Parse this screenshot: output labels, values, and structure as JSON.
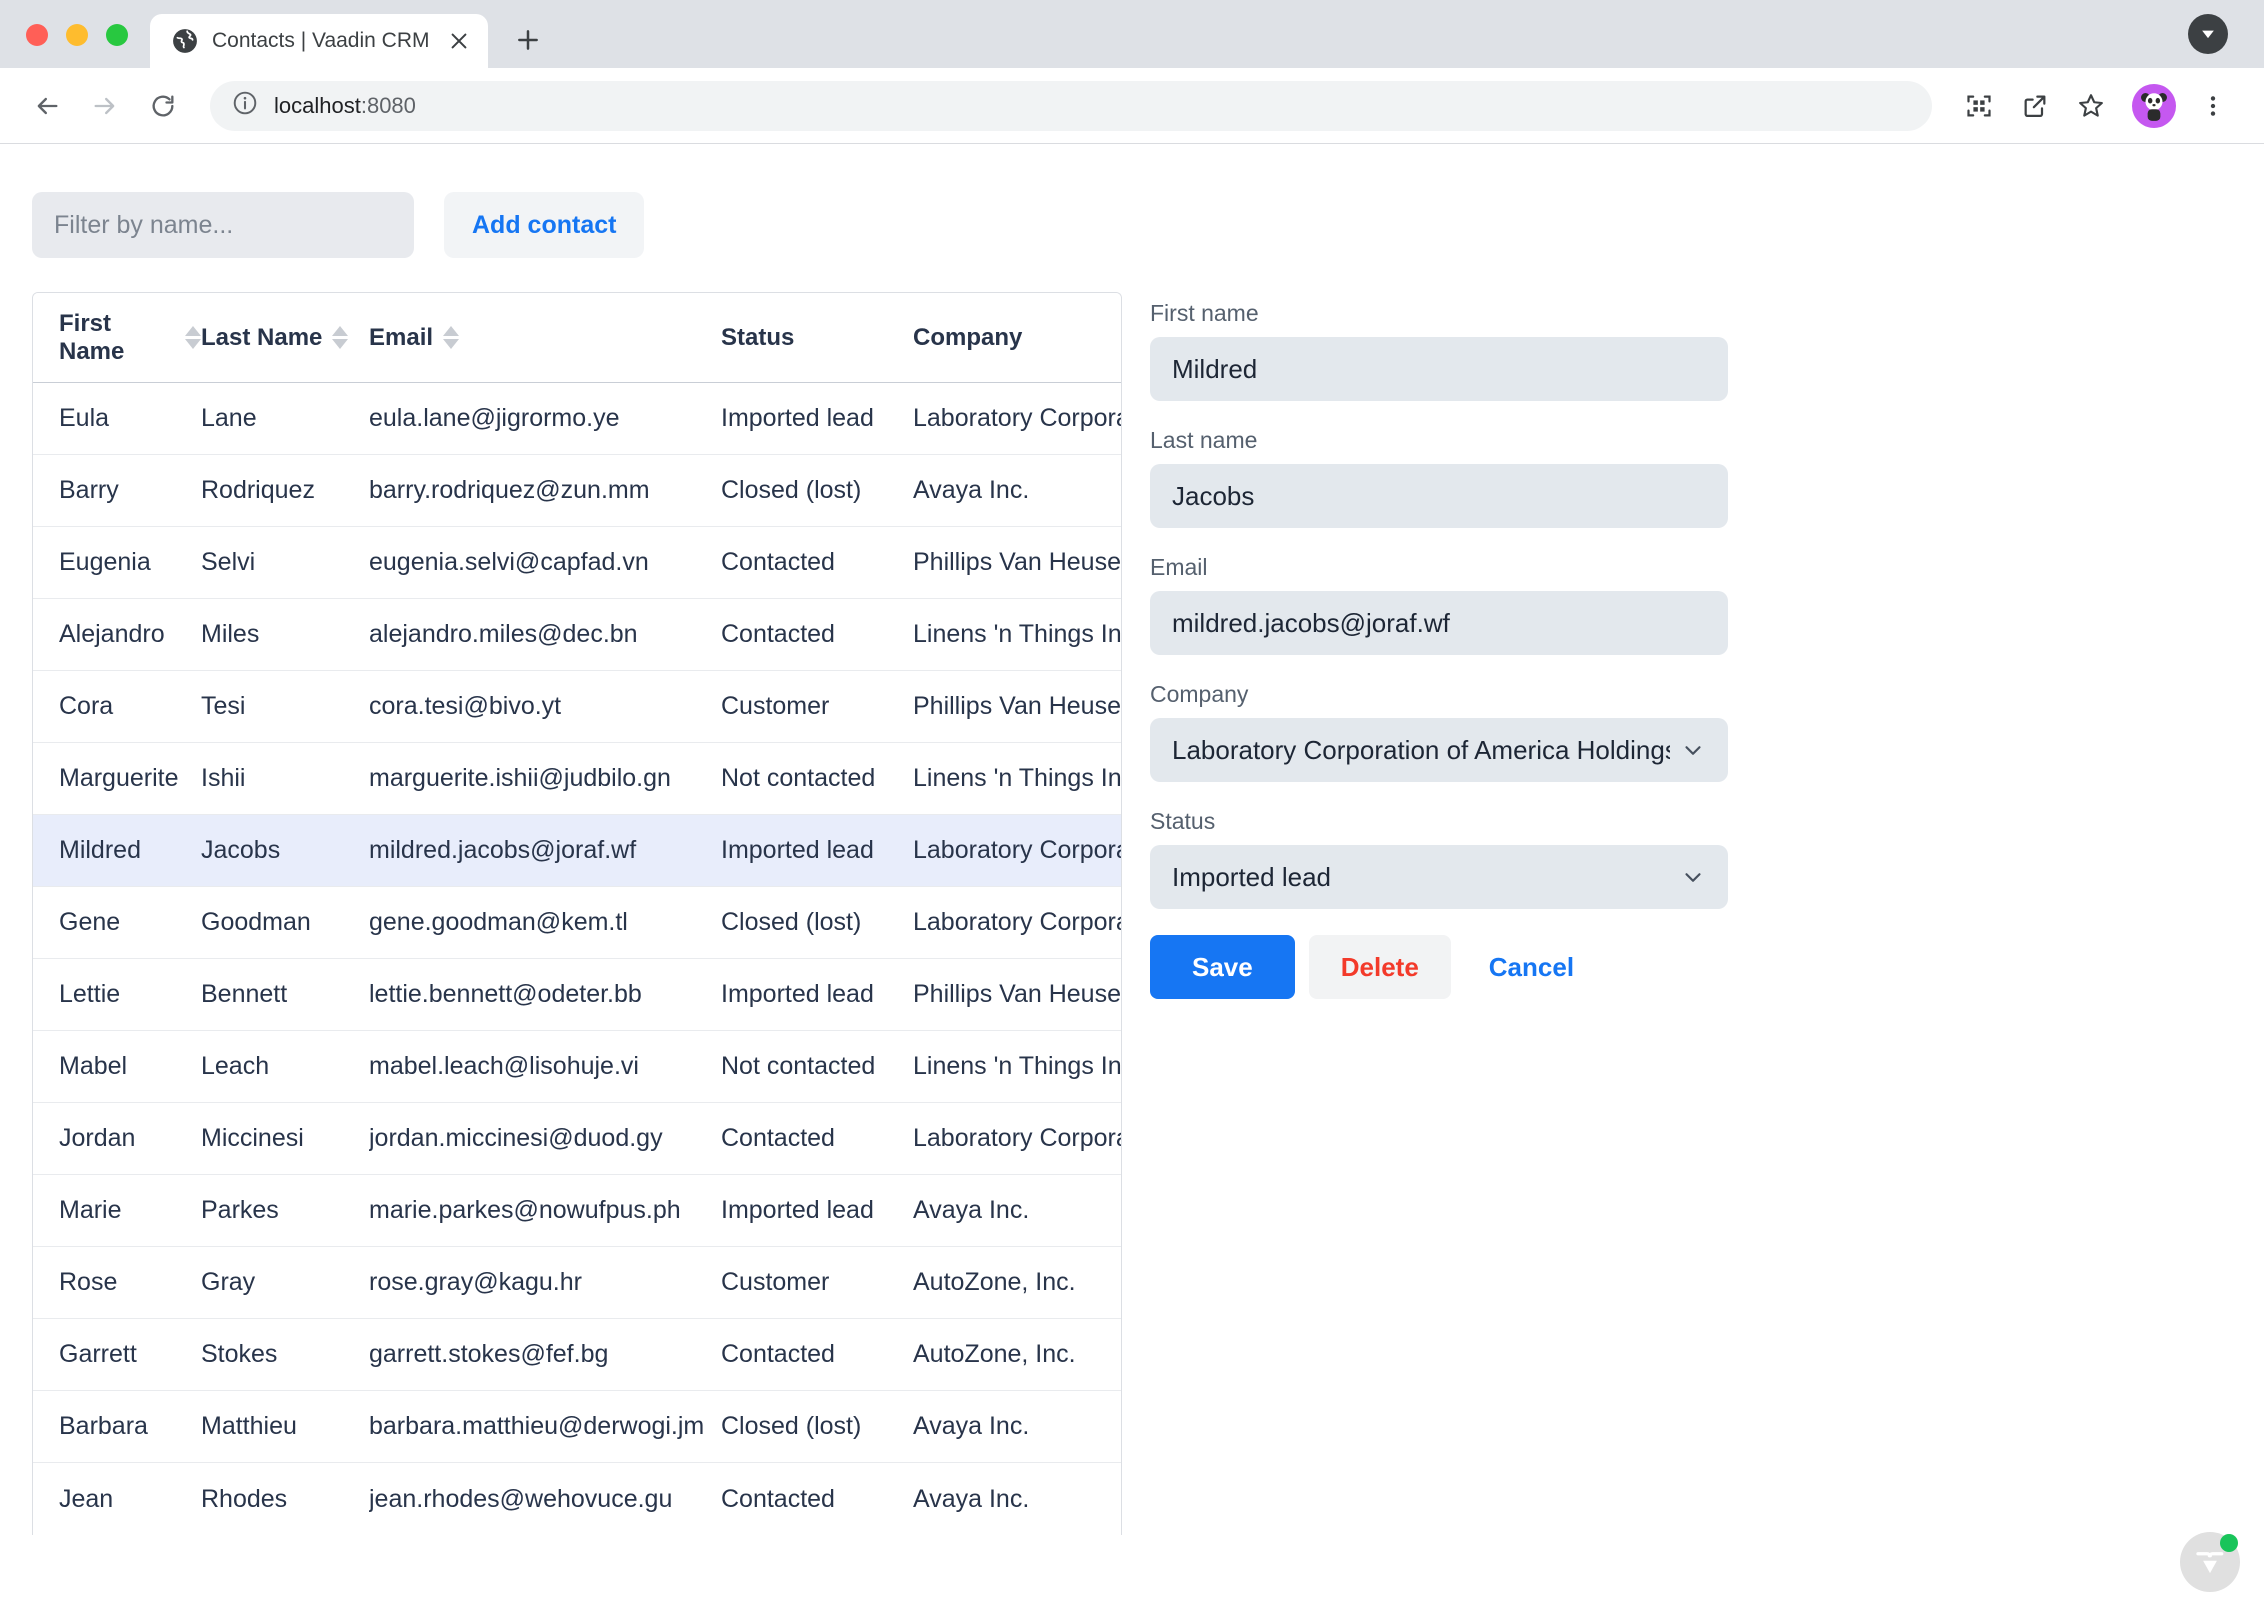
{
  "browser": {
    "tab": {
      "title": "Contacts | Vaadin CRM",
      "favicon_icon": "globe-icon",
      "close_icon": "close-icon"
    },
    "new_tab_icon": "plus-icon",
    "tabstrip_chevron_icon": "chevron-down-icon",
    "back_icon": "arrow-left-icon",
    "forward_icon": "arrow-right-icon",
    "reload_icon": "reload-icon",
    "site_info_icon": "info-icon",
    "url_host": "localhost",
    "url_port": ":8080",
    "toolbar_icons": [
      "qr-code-icon",
      "share-icon",
      "star-icon"
    ],
    "avatar_icon": "panda-avatar-icon",
    "menu_icon": "three-dot-menu-icon"
  },
  "toolbar": {
    "filter_placeholder": "Filter by name...",
    "filter_value": "",
    "add_contact_label": "Add contact"
  },
  "grid": {
    "columns": [
      {
        "label": "First Name",
        "sortable": true
      },
      {
        "label": "Last Name",
        "sortable": true
      },
      {
        "label": "Email",
        "sortable": true
      },
      {
        "label": "Status",
        "sortable": false
      },
      {
        "label": "Company",
        "sortable": false
      }
    ],
    "rows": [
      {
        "first": "Eula",
        "last": "Lane",
        "email": "eula.lane@jigrormo.ye",
        "status": "Imported lead",
        "company": "Laboratory Corporation of America Holdings",
        "selected": false
      },
      {
        "first": "Barry",
        "last": "Rodriquez",
        "email": "barry.rodriquez@zun.mm",
        "status": "Closed (lost)",
        "company": "Avaya Inc.",
        "selected": false
      },
      {
        "first": "Eugenia",
        "last": "Selvi",
        "email": "eugenia.selvi@capfad.vn",
        "status": "Contacted",
        "company": "Phillips Van Heusen",
        "selected": false
      },
      {
        "first": "Alejandro",
        "last": "Miles",
        "email": "alejandro.miles@dec.bn",
        "status": "Contacted",
        "company": "Linens 'n Things Inc.",
        "selected": false
      },
      {
        "first": "Cora",
        "last": "Tesi",
        "email": "cora.tesi@bivo.yt",
        "status": "Customer",
        "company": "Phillips Van Heusen",
        "selected": false
      },
      {
        "first": "Marguerite",
        "last": "Ishii",
        "email": "marguerite.ishii@judbilo.gn",
        "status": "Not contacted",
        "company": "Linens 'n Things Inc.",
        "selected": false
      },
      {
        "first": "Mildred",
        "last": "Jacobs",
        "email": "mildred.jacobs@joraf.wf",
        "status": "Imported lead",
        "company": "Laboratory Corporation of America Holdings",
        "selected": true
      },
      {
        "first": "Gene",
        "last": "Goodman",
        "email": "gene.goodman@kem.tl",
        "status": "Closed (lost)",
        "company": "Laboratory Corporation of America Holdings",
        "selected": false
      },
      {
        "first": "Lettie",
        "last": "Bennett",
        "email": "lettie.bennett@odeter.bb",
        "status": "Imported lead",
        "company": "Phillips Van Heusen",
        "selected": false
      },
      {
        "first": "Mabel",
        "last": "Leach",
        "email": "mabel.leach@lisohuje.vi",
        "status": "Not contacted",
        "company": "Linens 'n Things Inc.",
        "selected": false
      },
      {
        "first": "Jordan",
        "last": "Miccinesi",
        "email": "jordan.miccinesi@duod.gy",
        "status": "Contacted",
        "company": "Laboratory Corporation of America Holdings",
        "selected": false
      },
      {
        "first": "Marie",
        "last": "Parkes",
        "email": "marie.parkes@nowufpus.ph",
        "status": "Imported lead",
        "company": "Avaya Inc.",
        "selected": false
      },
      {
        "first": "Rose",
        "last": "Gray",
        "email": "rose.gray@kagu.hr",
        "status": "Customer",
        "company": "AutoZone, Inc.",
        "selected": false
      },
      {
        "first": "Garrett",
        "last": "Stokes",
        "email": "garrett.stokes@fef.bg",
        "status": "Contacted",
        "company": "AutoZone, Inc.",
        "selected": false
      },
      {
        "first": "Barbara",
        "last": "Matthieu",
        "email": "barbara.matthieu@derwogi.jm",
        "status": "Closed (lost)",
        "company": "Avaya Inc.",
        "selected": false
      },
      {
        "first": "Jean",
        "last": "Rhodes",
        "email": "jean.rhodes@wehovuce.gu",
        "status": "Contacted",
        "company": "Avaya Inc.",
        "selected": false
      }
    ]
  },
  "form": {
    "first_name_label": "First name",
    "first_name_value": "Mildred",
    "last_name_label": "Last name",
    "last_name_value": "Jacobs",
    "email_label": "Email",
    "email_value": "mildred.jacobs@joraf.wf",
    "company_label": "Company",
    "company_value": "Laboratory Corporation of America Holdings",
    "status_label": "Status",
    "status_value": "Imported lead",
    "save_label": "Save",
    "delete_label": "Delete",
    "cancel_label": "Cancel",
    "dropdown_icon": "chevron-down-icon"
  },
  "footer": {
    "badge_icon": "vaadin-logo-icon",
    "status_dot_color": "#19c45a"
  },
  "colors": {
    "accent_blue": "#1676f3",
    "danger_red": "#f33a2a",
    "selected_row": "#e8edfb",
    "field_bg": "#e3e8ed"
  }
}
